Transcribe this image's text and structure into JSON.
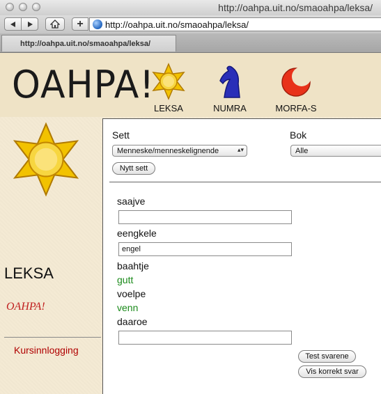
{
  "window": {
    "title": "http://oahpa.uit.no/smaoahpa/leksa/"
  },
  "toolbar": {
    "back_icon": "back-arrow-icon",
    "forward_icon": "forward-arrow-icon",
    "home_icon": "home-icon",
    "add_label": "+",
    "url": "http://oahpa.uit.no/smaoahpa/leksa/"
  },
  "tab": {
    "title": "http://oahpa.uit.no/smaoahpa/leksa/"
  },
  "header": {
    "logo": "OAHPA!",
    "nav": [
      {
        "label": "LEKSA",
        "icon": "sun-icon"
      },
      {
        "label": "NUMRA",
        "icon": "knight-icon"
      },
      {
        "label": "MORFA-S",
        "icon": "moon-icon"
      }
    ]
  },
  "sidebar": {
    "title": "LEKSA",
    "subtitle": "OAHPA!",
    "link": "Kursinnlogging",
    "icon": "sun-icon"
  },
  "form": {
    "sett_label": "Sett",
    "sett_value": "Menneske/menneskelignende",
    "bok_label": "Bok",
    "bok_value": "Alle",
    "nytt_sett": "Nytt sett"
  },
  "exercise": {
    "items": [
      {
        "word": "saajve",
        "answer": ""
      },
      {
        "word": "eengkele",
        "answer": "engel"
      },
      {
        "word": "baahtje",
        "correct": "gutt"
      },
      {
        "word": "voelpe",
        "correct": "venn"
      },
      {
        "word": "daaroe",
        "answer": ""
      }
    ],
    "test_button": "Test svarene",
    "show_button": "Vis korrekt svar"
  },
  "colors": {
    "accent_red": "#b00000",
    "correct_green": "#1a8a1a",
    "page_bg": "#f4ead3"
  }
}
